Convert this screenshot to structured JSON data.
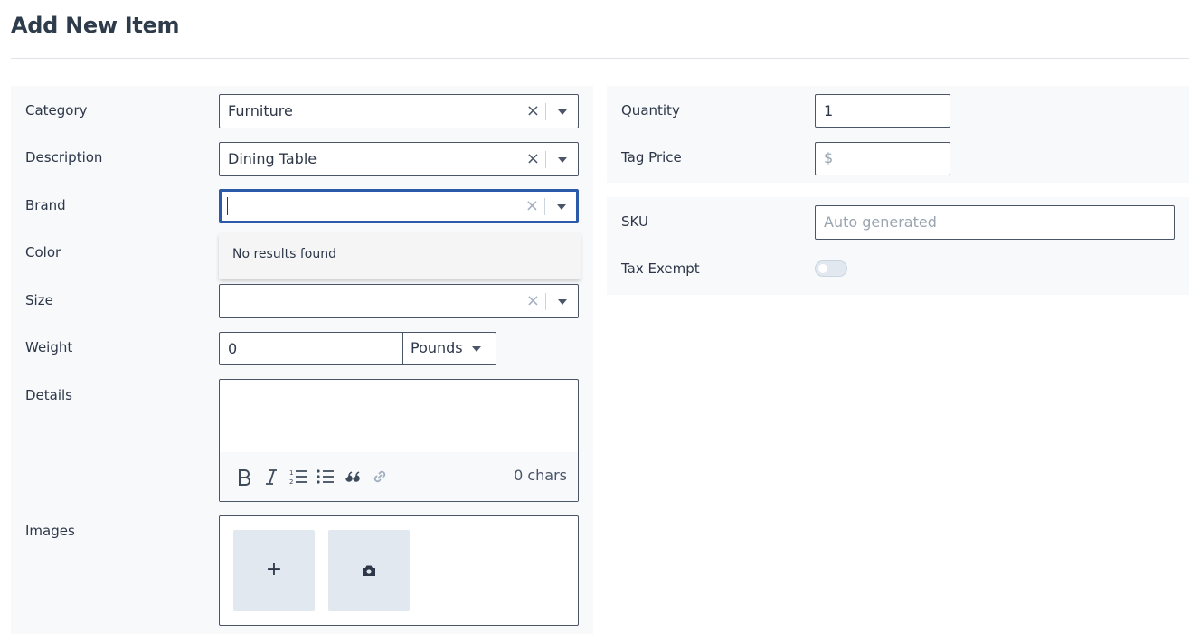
{
  "page": {
    "title": "Add New Item"
  },
  "form": {
    "category": {
      "label": "Category",
      "value": "Furniture"
    },
    "description": {
      "label": "Description",
      "value": "Dining Table"
    },
    "brand": {
      "label": "Brand",
      "value": "",
      "dropdown_message": "No results found"
    },
    "color": {
      "label": "Color"
    },
    "size": {
      "label": "Size",
      "value": ""
    },
    "weight": {
      "label": "Weight",
      "value": "0",
      "unit": "Pounds"
    },
    "details": {
      "label": "Details",
      "char_count": "0 chars"
    },
    "images": {
      "label": "Images",
      "add_symbol": "+"
    },
    "quantity": {
      "label": "Quantity",
      "value": "1"
    },
    "tag_price": {
      "label": "Tag Price",
      "prefix": "$"
    },
    "sku": {
      "label": "SKU",
      "placeholder": "Auto generated"
    },
    "tax_exempt": {
      "label": "Tax Exempt",
      "enabled": false
    }
  },
  "select_controls": {
    "clear_symbol": "×"
  },
  "editor_toolbar": [
    "bold-icon",
    "italic-icon",
    "ordered-list-icon",
    "bullet-list-icon",
    "quote-icon",
    "link-icon"
  ],
  "colors": {
    "focus_border": "#2b5aa8",
    "panel_background": "#f7f9fb",
    "tile_background": "#e2e8f0"
  }
}
